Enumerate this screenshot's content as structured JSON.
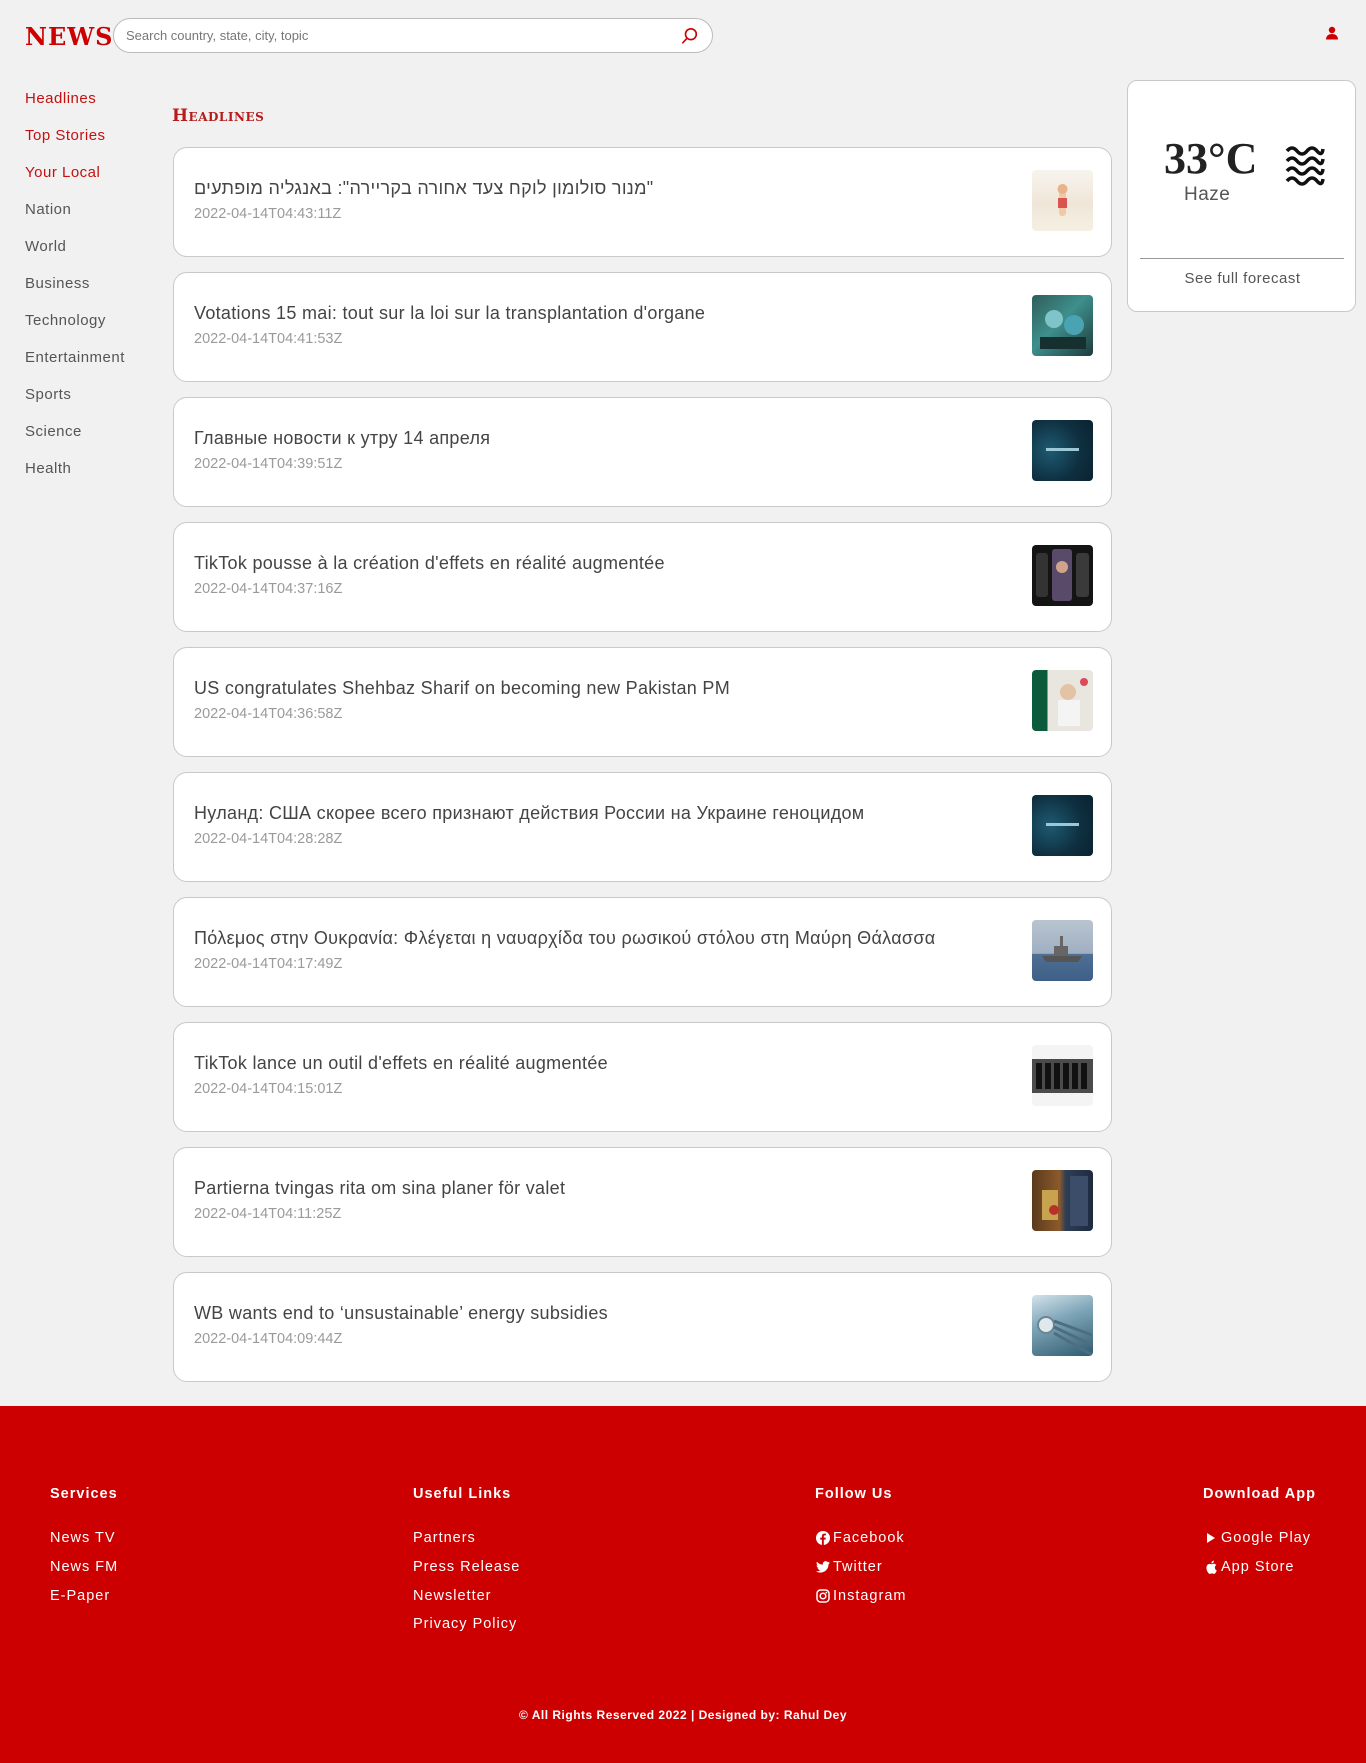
{
  "header": {
    "logo": "NEWS",
    "search_placeholder": "Search country, state, city, topic"
  },
  "sidebar": {
    "items": [
      {
        "label": "Headlines",
        "active": true
      },
      {
        "label": "Top Stories",
        "active": true
      },
      {
        "label": "Your Local",
        "active": true
      },
      {
        "label": "Nation"
      },
      {
        "label": "World"
      },
      {
        "label": "Business"
      },
      {
        "label": "Technology"
      },
      {
        "label": "Entertainment"
      },
      {
        "label": "Sports"
      },
      {
        "label": "Science"
      },
      {
        "label": "Health"
      }
    ]
  },
  "main": {
    "section_title": "Headlines",
    "articles": [
      {
        "title": "מנור סולומון לוקח צעד אחורה בקריירה\": באנגליה מופתעים\"",
        "date": "2022-04-14T04:43:11Z"
      },
      {
        "title": "Votations 15 mai: tout sur la loi sur la transplantation d'organe",
        "date": "2022-04-14T04:41:53Z"
      },
      {
        "title": "Главные новости к утру 14 апреля",
        "date": "2022-04-14T04:39:51Z"
      },
      {
        "title": "TikTok pousse à la création d'effets en réalité augmentée",
        "date": "2022-04-14T04:37:16Z"
      },
      {
        "title": "US congratulates Shehbaz Sharif on becoming new Pakistan PM",
        "date": "2022-04-14T04:36:58Z"
      },
      {
        "title": "Нуланд: США скорее всего признают действия России на Украине геноцидом",
        "date": "2022-04-14T04:28:28Z"
      },
      {
        "title": "Πόλεμος στην Ουκρανία: Φλέγεται η ναυαρχίδα του ρωσικού στόλου στη Μαύρη Θάλασσα",
        "date": "2022-04-14T04:17:49Z"
      },
      {
        "title": "TikTok lance un outil d'effets en réalité augmentée",
        "date": "2022-04-14T04:15:01Z"
      },
      {
        "title": "Partierna tvingas rita om sina planer för valet",
        "date": "2022-04-14T04:11:25Z"
      },
      {
        "title": "WB wants end to ‘unsustainable’ energy subsidies",
        "date": "2022-04-14T04:09:44Z"
      }
    ]
  },
  "weather": {
    "temp": "33°C",
    "description": "Haze",
    "forecast_link": "See full forecast",
    "icon": "haze-icon"
  },
  "footer": {
    "services": {
      "heading": "Services",
      "links": [
        "News TV",
        "News FM",
        "E-Paper"
      ]
    },
    "useful_links": {
      "heading": "Useful Links",
      "links": [
        "Partners",
        "Press Release",
        "Newsletter",
        "Privacy Policy"
      ]
    },
    "follow_us": {
      "heading": "Follow Us",
      "links": [
        "Facebook",
        "Twitter",
        "Instagram"
      ]
    },
    "download_app": {
      "heading": "Download App",
      "links": [
        "Google Play",
        "App Store"
      ]
    },
    "copyright": "© All Rights Reserved 2022 | Designed by: Rahul Dey"
  },
  "colors": {
    "brand": "#cc0000",
    "background": "#f1f1f1",
    "card": "#ffffff"
  }
}
